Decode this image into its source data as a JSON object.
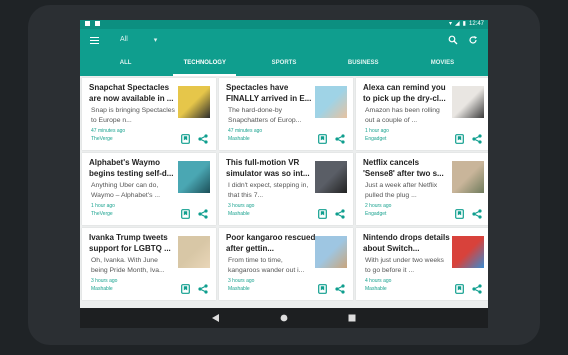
{
  "status": {
    "time": "12:47"
  },
  "toolbar": {
    "filter_label": "All",
    "accent": "#0f9e8e"
  },
  "tabs": [
    "ALL",
    "TECHNOLOGY",
    "SPORTS",
    "BUSINESS",
    "MOVIES"
  ],
  "active_tab": "TECHNOLOGY",
  "cards": [
    {
      "title": "Snapchat Spectacles are now available in ...",
      "snippet": "Snap is bringing Spectacles to Europe n...",
      "time": "47 minutes ago",
      "source": "TheVerge",
      "thumb": "sunglasses"
    },
    {
      "title": "Spectacles have FINALLY arrived in E...",
      "snippet": "The hard-done-by Snapchatters of Europ...",
      "time": "47 minutes ago",
      "source": "Mashable",
      "thumb": "person-glasses"
    },
    {
      "title": "Alexa can remind you to pick up the dry-cl...",
      "snippet": "Amazon has been rolling out a couple of ...",
      "time": "1 hour ago",
      "source": "Engadget",
      "thumb": "echo"
    },
    {
      "title": "Alphabet's Waymo begins testing self-d...",
      "snippet": "Anything Uber can do, Waymo – Alphabet's ...",
      "time": "1 hour ago",
      "source": "TheVerge",
      "thumb": "car"
    },
    {
      "title": "This full-motion VR simulator was so int...",
      "snippet": "I didn't expect, stepping in, that this 7...",
      "time": "3 hours ago",
      "source": "Mashable",
      "thumb": "vr"
    },
    {
      "title": "Netflix cancels 'Sense8' after two s...",
      "snippet": "Just a week after Netflix pulled the plug ...",
      "time": "2 hours ago",
      "source": "Engadget",
      "thumb": "group"
    },
    {
      "title": "Ivanka Trump tweets support for LGBTQ ...",
      "snippet": "Oh, Ivanka. With June being Pride Month, Iva...",
      "time": "3 hours ago",
      "source": "Mashable",
      "thumb": "ivanka"
    },
    {
      "title": "Poor kangaroo rescued after gettin...",
      "snippet": "From time to time, kangaroos wander out i...",
      "time": "3 hours ago",
      "source": "Mashable",
      "thumb": "kangaroo"
    },
    {
      "title": "Nintendo drops details about Switch...",
      "snippet": "With just under two weeks to go before it ...",
      "time": "4 hours ago",
      "source": "Mashable",
      "thumb": "nintendo"
    }
  ]
}
